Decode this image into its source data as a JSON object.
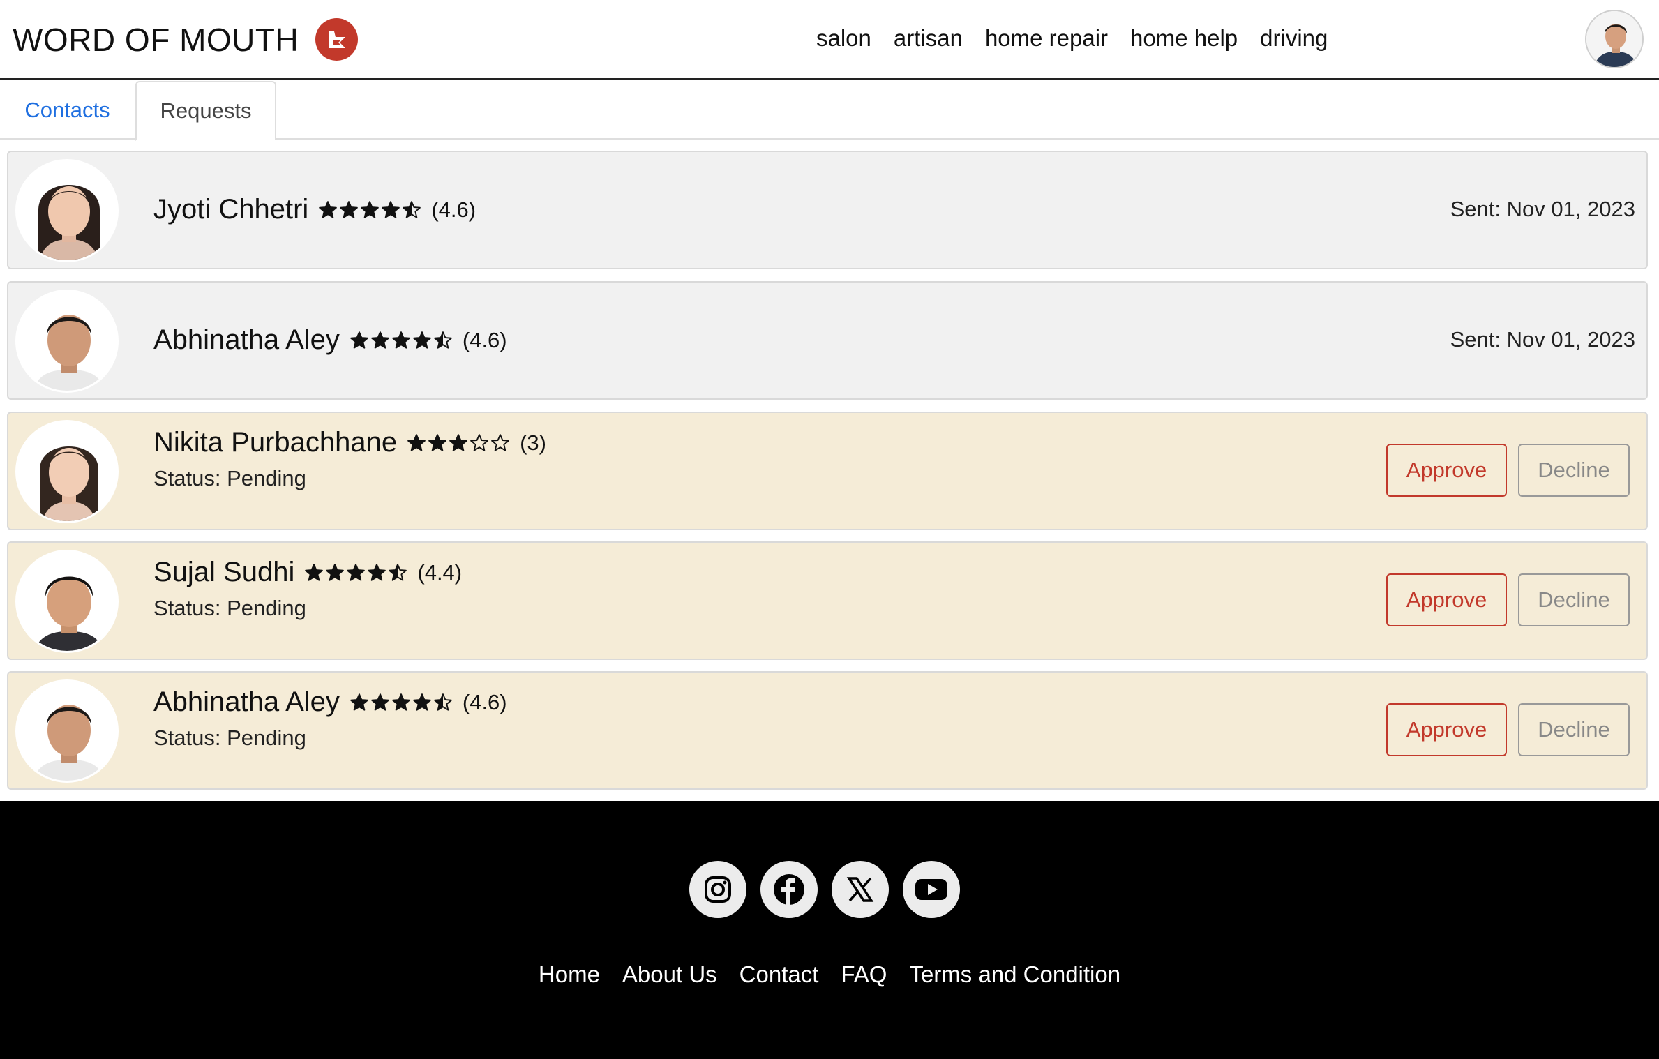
{
  "header": {
    "brand": "WORD OF MOUTH",
    "nav": [
      "salon",
      "artisan",
      "home repair",
      "home help",
      "driving"
    ]
  },
  "tabs": [
    {
      "label": "Contacts",
      "active": false
    },
    {
      "label": "Requests",
      "active": true
    }
  ],
  "requests": [
    {
      "name": "Jyoti Chhetri",
      "rating": 4.6,
      "rating_text": "(4.6)",
      "kind": "sent",
      "sent_text": "Sent: Nov 01, 2023"
    },
    {
      "name": "Abhinatha Aley",
      "rating": 4.6,
      "rating_text": "(4.6)",
      "kind": "sent",
      "sent_text": "Sent: Nov 01, 2023"
    },
    {
      "name": "Nikita Purbachhane",
      "rating": 3,
      "rating_text": "(3)",
      "kind": "pending",
      "status_text": "Status: Pending",
      "approve_label": "Approve",
      "decline_label": "Decline"
    },
    {
      "name": "Sujal Sudhi",
      "rating": 4.4,
      "rating_text": "(4.4)",
      "kind": "pending",
      "status_text": "Status: Pending",
      "approve_label": "Approve",
      "decline_label": "Decline"
    },
    {
      "name": "Abhinatha Aley",
      "rating": 4.6,
      "rating_text": "(4.6)",
      "kind": "pending",
      "status_text": "Status: Pending",
      "approve_label": "Approve",
      "decline_label": "Decline"
    }
  ],
  "footer": {
    "socials": [
      "instagram-icon",
      "facebook-icon",
      "x-icon",
      "youtube-icon"
    ],
    "links": [
      "Home",
      "About Us",
      "Contact",
      "FAQ",
      "Terms and Condition"
    ]
  },
  "colors": {
    "accent": "#c2392b",
    "tab_active_link": "#1f6fe0",
    "sent_card_bg": "#f1f1f1",
    "pending_card_bg": "#f5ecd7",
    "footer_bg": "#000000"
  }
}
